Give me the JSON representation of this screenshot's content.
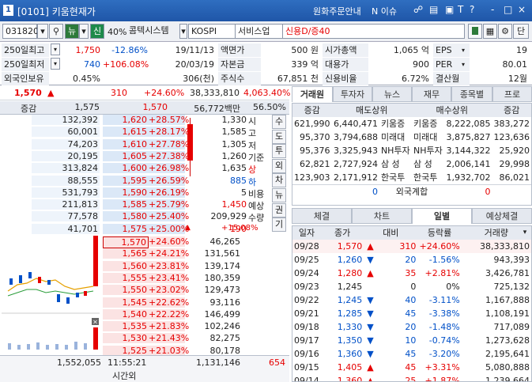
{
  "window": {
    "num": "1",
    "title": "[0101] 키움현재가",
    "menu1": "원화주문안내",
    "menu2": "N 이슈",
    "icons": [
      "T",
      "?",
      "-",
      "□",
      "×"
    ]
  },
  "toolbar": {
    "code": "031820",
    "newmark": "뉴",
    "credit": "신",
    "margin": "40%",
    "name": "콤텍시스템",
    "market": "KOSPI",
    "sector": "서비스업",
    "credit_info": "신용D/증40",
    "view_btn": "단"
  },
  "info": [
    [
      {
        "l": "250일최고",
        "v1": "1,750",
        "v2": "-12.86%",
        "v3": "19/11/13"
      },
      {
        "l": "액면가",
        "v": "500 원"
      },
      {
        "l": "시가총액",
        "v": "1,065 억"
      },
      {
        "l": "EPS",
        "v": "19"
      }
    ],
    [
      {
        "l": "250일최저",
        "v1": "740",
        "v2": "+106.08%",
        "v3": "20/03/19"
      },
      {
        "l": "자본금",
        "v": "339 억"
      },
      {
        "l": "대용가",
        "v": "900"
      },
      {
        "l": "PER",
        "v": "80.01"
      }
    ],
    [
      {
        "l": "외국인보유",
        "v1": "0.45%",
        "v2": "",
        "v3": "306(천)"
      },
      {
        "l": "주식수",
        "v": "67,851 천"
      },
      {
        "l": "신용비율",
        "v": "6.72%"
      },
      {
        "l": "결산월",
        "v": "12월"
      }
    ]
  ],
  "quote": {
    "price": "1,570",
    "arrow": "▲",
    "change": "310",
    "pct": "+24.60%",
    "volume": "38,333,810",
    "vol_pct": "4,063.40%",
    "hdr_label": "증감",
    "prev_close": "1,575",
    "open": "1,570",
    "amount": "56,772백만",
    "turnover": "56.50%"
  },
  "asks": [
    {
      "qty": "132,392",
      "price": "1,620",
      "pct": "+28.57%"
    },
    {
      "qty": "60,001",
      "price": "1,615",
      "pct": "+28.17%"
    },
    {
      "qty": "74,203",
      "price": "1,610",
      "pct": "+27.78%"
    },
    {
      "qty": "20,195",
      "price": "1,605",
      "pct": "+27.38%"
    },
    {
      "qty": "313,824",
      "price": "1,600",
      "pct": "+26.98%"
    },
    {
      "qty": "88,555",
      "price": "1,595",
      "pct": "+26.59%"
    },
    {
      "qty": "531,793",
      "price": "1,590",
      "pct": "+26.19%"
    },
    {
      "qty": "211,813",
      "price": "1,585",
      "pct": "+25.79%"
    },
    {
      "qty": "77,578",
      "price": "1,580",
      "pct": "+25.40%"
    },
    {
      "qty": "41,701",
      "price": "1,575",
      "pct": "+25.00%"
    }
  ],
  "bids": [
    {
      "qty": "46,265",
      "price": "1,570",
      "pct": "+24.60%"
    },
    {
      "qty": "131,561",
      "price": "1,565",
      "pct": "+24.21%"
    },
    {
      "qty": "139,174",
      "price": "1,560",
      "pct": "+23.81%"
    },
    {
      "qty": "180,359",
      "price": "1,555",
      "pct": "+23.41%"
    },
    {
      "qty": "129,473",
      "price": "1,550",
      "pct": "+23.02%"
    },
    {
      "qty": "93,116",
      "price": "1,545",
      "pct": "+22.62%"
    },
    {
      "qty": "146,499",
      "price": "1,540",
      "pct": "+22.22%"
    },
    {
      "qty": "102,246",
      "price": "1,535",
      "pct": "+21.83%"
    },
    {
      "qty": "82,275",
      "price": "1,530",
      "pct": "+21.43%"
    },
    {
      "qty": "80,178",
      "price": "1,525",
      "pct": "+21.03%"
    }
  ],
  "stats": [
    {
      "v": "1,330",
      "l": "시"
    },
    {
      "v": "1,585",
      "l": "고"
    },
    {
      "v": "1,305",
      "l": "저"
    },
    {
      "v": "1,260",
      "l": "기준"
    },
    {
      "v": "1,635",
      "l": "상"
    },
    {
      "v": "885",
      "l": "하"
    },
    {
      "v": "5",
      "l": "비용"
    },
    {
      "v": "1,450",
      "l": "예상"
    },
    {
      "v": "209,929",
      "l": "수량"
    },
    {
      "v": "190",
      "l": "+15.08%"
    }
  ],
  "side_btns": [
    "수",
    "도",
    "투",
    "외",
    "차",
    "뉴",
    "권",
    "기"
  ],
  "bottom": {
    "ask_total": "1,552,055",
    "time": "11:55:21",
    "time_label": "시간외",
    "bid_total": "1,131,146",
    "ask_total2": "654",
    "marker": "654"
  },
  "right_tabs": [
    "거래원",
    "투자자",
    "뉴스",
    "재무",
    "종목별",
    "프로"
  ],
  "broker": {
    "hdr": [
      "증감",
      "매도상위",
      "매수상위",
      "증감"
    ],
    "rows": [
      {
        "sq": "621,990",
        "sv": "6,440,471",
        "sn": "키움증",
        "bn": "키움증",
        "bv": "8,222,085",
        "bq": "383,272"
      },
      {
        "sq": "95,370",
        "sv": "3,794,688",
        "sn": "미래대",
        "bn": "미래대",
        "bv": "3,875,827",
        "bq": "123,636"
      },
      {
        "sq": "95,376",
        "sv": "3,325,943",
        "sn": "NH투자",
        "bn": "NH투자",
        "bv": "3,144,322",
        "bq": "25,920"
      },
      {
        "sq": "62,821",
        "sv": "2,727,924",
        "sn": "삼 성",
        "bn": "삼 성",
        "bv": "2,006,141",
        "bq": "29,998"
      },
      {
        "sq": "123,903",
        "sv": "2,171,912",
        "sn": "한국투",
        "bn": "한국투",
        "bv": "1,932,702",
        "bq": "86,021"
      }
    ],
    "foreign": {
      "sv": "0",
      "label": "외국계합",
      "bv": "0"
    }
  },
  "daily_tabs": [
    "체결",
    "차트",
    "일별",
    "예상체결"
  ],
  "daily": {
    "hdr": [
      "일자",
      "종가",
      "대비",
      "등락률",
      "거래량"
    ],
    "rows": [
      {
        "d": "09/28",
        "c": "1,570",
        "a": "▲",
        "ch": "310",
        "p": "+24.60%",
        "v": "38,333,810",
        "t": "up"
      },
      {
        "d": "09/25",
        "c": "1,260",
        "a": "▼",
        "ch": "20",
        "p": "-1.56%",
        "v": "943,393",
        "t": "dn"
      },
      {
        "d": "09/24",
        "c": "1,280",
        "a": "▲",
        "ch": "35",
        "p": "+2.81%",
        "v": "3,426,781",
        "t": "up"
      },
      {
        "d": "09/23",
        "c": "1,245",
        "a": "",
        "ch": "0",
        "p": "0%",
        "v": "725,132",
        "t": "eq"
      },
      {
        "d": "09/22",
        "c": "1,245",
        "a": "▼",
        "ch": "40",
        "p": "-3.11%",
        "v": "1,167,888",
        "t": "dn"
      },
      {
        "d": "09/21",
        "c": "1,285",
        "a": "▼",
        "ch": "45",
        "p": "-3.38%",
        "v": "1,108,191",
        "t": "dn"
      },
      {
        "d": "09/18",
        "c": "1,330",
        "a": "▼",
        "ch": "20",
        "p": "-1.48%",
        "v": "717,089",
        "t": "dn"
      },
      {
        "d": "09/17",
        "c": "1,350",
        "a": "▼",
        "ch": "10",
        "p": "-0.74%",
        "v": "1,273,628",
        "t": "dn"
      },
      {
        "d": "09/16",
        "c": "1,360",
        "a": "▼",
        "ch": "45",
        "p": "-3.20%",
        "v": "2,195,641",
        "t": "dn"
      },
      {
        "d": "09/15",
        "c": "1,405",
        "a": "▲",
        "ch": "45",
        "p": "+3.31%",
        "v": "5,080,888",
        "t": "up"
      },
      {
        "d": "09/14",
        "c": "1,360",
        "a": "▲",
        "ch": "25",
        "p": "+1.87%",
        "v": "1,239,664",
        "t": "up"
      }
    ]
  },
  "colors": {
    "up": "#e60000",
    "down": "#0050c8",
    "header": "#2f6ec0"
  }
}
